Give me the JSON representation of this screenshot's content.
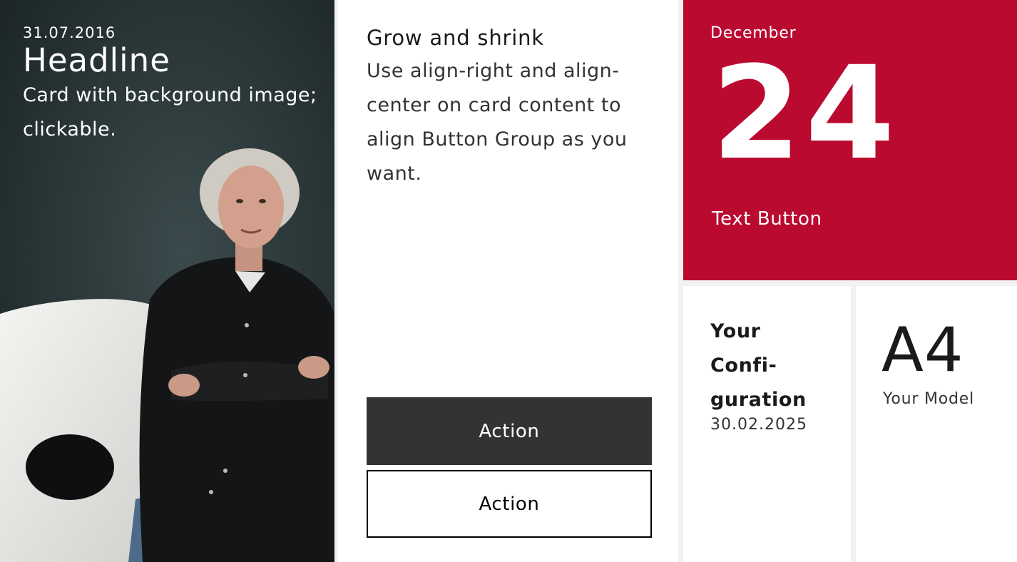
{
  "image_card": {
    "date": "31.07.2016",
    "headline": "Headline",
    "description": "Card with background image; clickable."
  },
  "text_card": {
    "title": "Grow and shrink",
    "body": "Use align-right and align-center on card content to align Button Group as you want.",
    "primary_action": "Action",
    "secondary_action": "Action"
  },
  "date_card": {
    "month": "December",
    "day": "24",
    "text_button": "Text Button",
    "background_color": "#bb0a30"
  },
  "config_card": {
    "title": "Your Confi-guration",
    "date": "30.02.2025"
  },
  "model_card": {
    "model": "A4",
    "label": "Your Model"
  },
  "colors": {
    "accent": "#bb0a30",
    "primary_button": "#333333",
    "background": "#f2f2f2"
  }
}
